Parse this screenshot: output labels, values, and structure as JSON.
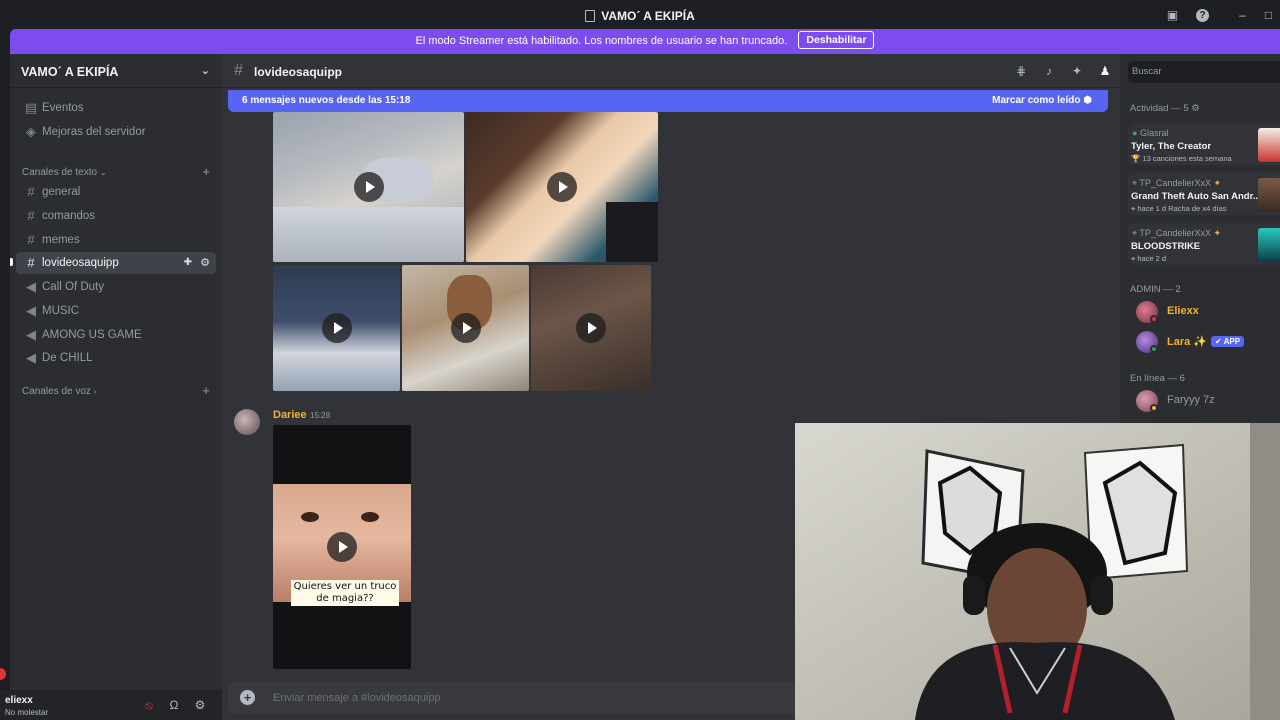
{
  "window": {
    "title": "VAMO´ A EKIPÍA"
  },
  "streamer_banner": {
    "text": "El modo Streamer está habilitado. Los nombres de usuario se han truncado.",
    "button": "Deshabilitar"
  },
  "sidebar": {
    "server_name": "VAMO´ A EKIPÍA",
    "top_items": [
      {
        "label": "Eventos",
        "icon": "calendar-icon"
      },
      {
        "label": "Mejoras del servidor",
        "icon": "boost-icon"
      }
    ],
    "text_category": "Canales de texto",
    "text_channels": [
      "general",
      "comandos",
      "memes",
      "lovideosaquipp"
    ],
    "voice_like_channels": [
      "Call Of Duty",
      "MUSIC",
      "AMONG US GAME",
      "De CHILL"
    ],
    "voice_category": "Canales de voz"
  },
  "user_panel": {
    "username": "eliexx",
    "status": "No molestar"
  },
  "channel": {
    "name": "lovideosaquipp"
  },
  "new_messages_bar": {
    "text": "6 mensajes nuevos desde las 15:18",
    "mark_read": "Marcar como leído"
  },
  "message": {
    "author": "Dariee",
    "time": "15:28",
    "video_caption": "Quieres ver un truco de magia??"
  },
  "composer": {
    "placeholder": "Enviar mensaje a #lovideosaquipp"
  },
  "members": {
    "search_placeholder": "Buscar",
    "activity_header": "Actividad — 5",
    "activities": [
      {
        "user": "Glasral",
        "title": "Tyler, The Creator",
        "detail": "13 canciones esta semana"
      },
      {
        "user": "TP_CandelierXxX",
        "title": "Grand Theft Auto San Andr...",
        "detail": "hace 1 d   Racha de x4 días"
      },
      {
        "user": "TP_CandelierXxX",
        "title": "BLOODSTRIKE",
        "detail": "hace 2 d"
      }
    ],
    "admin_header": "ADMIN — 2",
    "admins": [
      {
        "name": "Eliexx",
        "color": "#f0b232"
      },
      {
        "name": "Lara ✨",
        "color": "#f0b232",
        "badge": "✔ APP"
      }
    ],
    "online_header": "En línea — 6",
    "online": [
      {
        "name": "Faryyy 7z",
        "color": "#949ba4"
      }
    ]
  },
  "colors": {
    "blurple": "#5865f2",
    "streamer_purple": "#7d4cef",
    "author_gold": "#f0b232",
    "dnd_red": "#da373c"
  }
}
